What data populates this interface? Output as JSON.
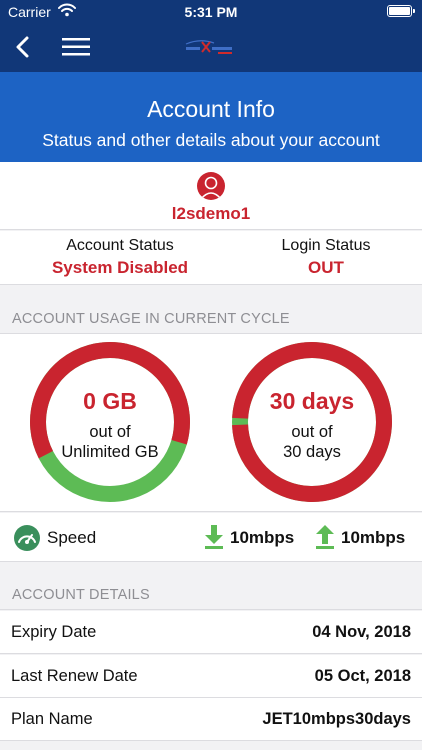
{
  "status_bar": {
    "carrier": "Carrier",
    "time": "5:31 PM"
  },
  "nav": {
    "back_icon": "chevron-left-icon",
    "menu_icon": "hamburger-menu-icon",
    "logo": "brand-logo"
  },
  "header": {
    "title": "Account Info",
    "subtitle": "Status and other details about your account"
  },
  "user": {
    "username": "l2sdemo1",
    "avatar_icon": "user-avatar-icon"
  },
  "status": {
    "account_label": "Account Status",
    "account_value": "System Disabled",
    "login_label": "Login Status",
    "login_value": "OUT"
  },
  "usage": {
    "heading": "ACCOUNT USAGE IN CURRENT CYCLE",
    "data": {
      "value": "0 GB",
      "out_of": "out of",
      "limit": "Unlimited GB",
      "used_fraction": 0.62
    },
    "days": {
      "value": "30 days",
      "out_of": "out of",
      "limit": "30 days",
      "used_fraction": 0.985
    }
  },
  "speed": {
    "label": "Speed",
    "download": "10mbps",
    "upload": "10mbps"
  },
  "details": {
    "heading": "ACCOUNT DETAILS",
    "rows": [
      {
        "label": "Expiry Date",
        "value": "04 Nov, 2018"
      },
      {
        "label": "Last Renew Date",
        "value": "05 Oct, 2018"
      },
      {
        "label": "Plan Name",
        "value": "JET10mbps30days"
      }
    ]
  },
  "colors": {
    "nav": "#113778",
    "header": "#1d63c4",
    "accent_red": "#c9242f",
    "accent_green": "#5dbb55"
  }
}
